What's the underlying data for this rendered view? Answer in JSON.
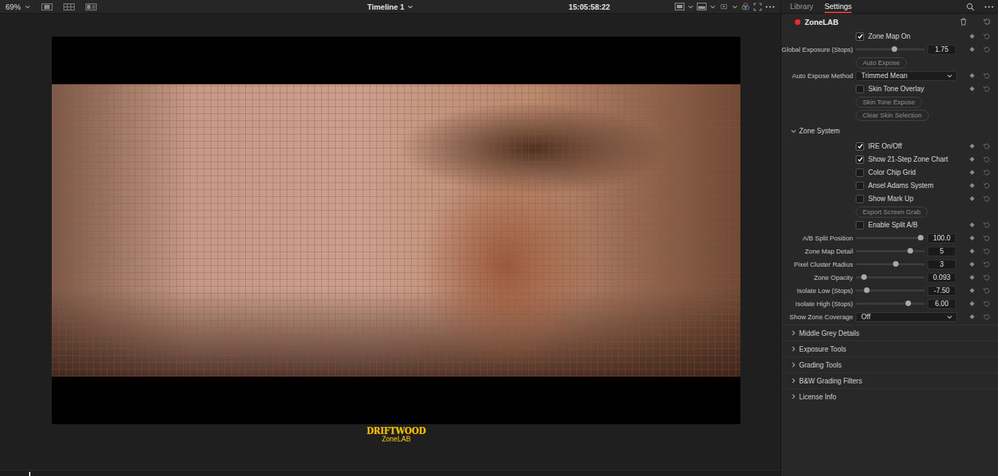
{
  "viewer": {
    "zoom": "69%",
    "timeline": "Timeline 1",
    "timecode": "15:05:58:22",
    "scrubber": {
      "level": 0.037
    }
  },
  "logo": {
    "title": "DRIFTWOOD",
    "subtitle": "ZoneLAB"
  },
  "panel": {
    "tabs": [
      {
        "label": "Library",
        "selected": false
      },
      {
        "label": "Settings",
        "selected": true
      }
    ],
    "plugin": {
      "name": "ZoneLAB",
      "enabled": true
    }
  },
  "controls": [
    {
      "kind": "checkbox",
      "label": "Zone Map On",
      "checked": true
    },
    {
      "kind": "slider",
      "label": "Global Exposure (Stops)",
      "value": "1.75",
      "level": 0.57
    },
    {
      "kind": "button",
      "label": "Auto Expose"
    },
    {
      "kind": "dropdown",
      "label": "Auto Expose Method",
      "value": "Trimmed Mean"
    },
    {
      "kind": "checkbox",
      "label": "Skin Tone Overlay",
      "checked": false
    },
    {
      "kind": "button",
      "label": "Skin Tone Expose"
    },
    {
      "kind": "button",
      "label": "Clear Skin Selection"
    }
  ],
  "zone_system": {
    "label": "Zone System",
    "expanded": true,
    "rows": [
      {
        "kind": "checkbox",
        "label": "IRE On/Off",
        "checked": true
      },
      {
        "kind": "checkbox",
        "label": "Show 21-Step Zone Chart",
        "checked": true
      },
      {
        "kind": "checkbox",
        "label": "Color Chip Grid",
        "checked": false
      },
      {
        "kind": "checkbox",
        "label": "Ansel Adams System",
        "checked": false
      },
      {
        "kind": "checkbox",
        "label": "Show Mark Up",
        "checked": false
      },
      {
        "kind": "button",
        "label": "Export Screen Grab"
      },
      {
        "kind": "checkbox",
        "label": "Enable Split A/B",
        "checked": false
      },
      {
        "kind": "slider",
        "label": "A/B Split Position",
        "value": "100.0",
        "level": 0.98
      },
      {
        "kind": "slider",
        "label": "Zone Map Detail",
        "value": "5",
        "level": 0.82
      },
      {
        "kind": "slider",
        "label": "Pixel Cluster Radius",
        "value": "3",
        "level": 0.59
      },
      {
        "kind": "slider",
        "label": "Zone Opacity",
        "value": "0.093",
        "level": 0.09
      },
      {
        "kind": "slider",
        "label": "Isolate Low (Stops)",
        "value": "-7.50",
        "level": 0.13
      },
      {
        "kind": "slider",
        "label": "Isolate High (Stops)",
        "value": "6.00",
        "level": 0.78
      },
      {
        "kind": "dropdown",
        "label": "Show Zone Coverage",
        "value": "Off"
      }
    ]
  },
  "sections": [
    {
      "label": "Middle Grey Details",
      "expanded": false
    },
    {
      "label": "Exposure Tools",
      "expanded": false
    },
    {
      "label": "Grading Tools",
      "expanded": false
    },
    {
      "label": "B&W Grading Filters",
      "expanded": false
    },
    {
      "label": "License Info",
      "expanded": false
    }
  ]
}
